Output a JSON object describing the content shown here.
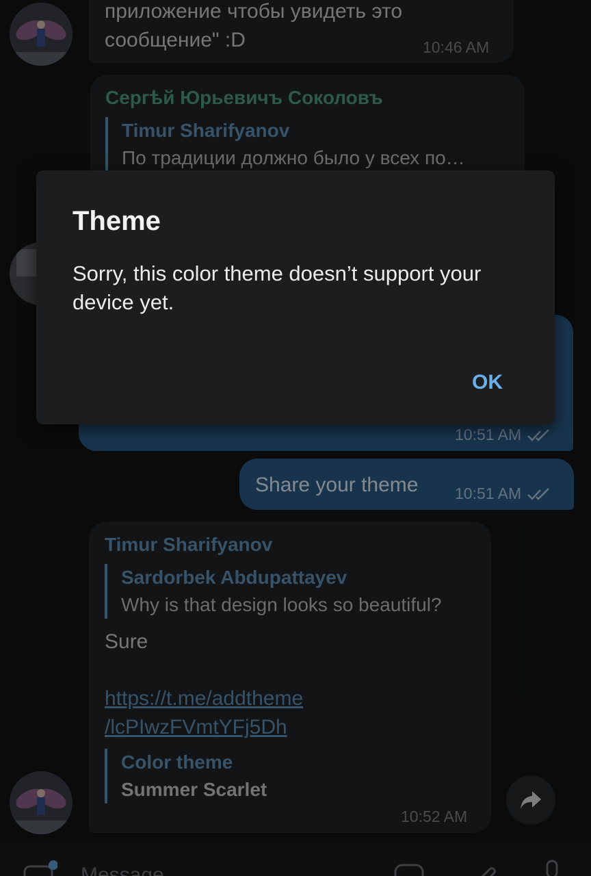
{
  "messages": {
    "top": {
      "line1": "приложение чтобы увидеть это",
      "line2": "сообщение\" :D",
      "time": "10:46 AM"
    },
    "sergey": {
      "sender": "Сергѣй Юрьевичъ Соколовъ",
      "reply_name": "Timur Sharifyanov",
      "reply_text": "По традиции должно было у всех по…"
    },
    "outgoing1": {
      "time": "10:51 AM"
    },
    "outgoing2": {
      "text": "Share your theme",
      "time": "10:51 AM"
    },
    "timur": {
      "sender": "Timur Sharifyanov",
      "reply_name": "Sardorbek Abdupattayev",
      "reply_text": "Why is that design looks so beautiful?",
      "text": "Sure",
      "link_line1": "https://t.me/addtheme",
      "link_line2": "/lcPIwzFVmtYFj5Dh",
      "preview_title": "Color theme",
      "preview_name": "Summer Scarlet",
      "time": "10:52 AM"
    }
  },
  "dialog": {
    "title": "Theme",
    "body": "Sorry, this color theme doesn’t support your device yet.",
    "ok_label": "OK"
  },
  "input": {
    "placeholder": "Message"
  },
  "colors": {
    "accent": "#6ab0ea",
    "outgoing_bubble": "#2a5a85",
    "incoming_bubble": "#222325",
    "dialog_bg": "#1c1d1e"
  },
  "icons": [
    "avatar",
    "double-check-icon",
    "share-icon",
    "emoji-icon",
    "attach-icon",
    "mic-icon",
    "sticker-icon"
  ]
}
